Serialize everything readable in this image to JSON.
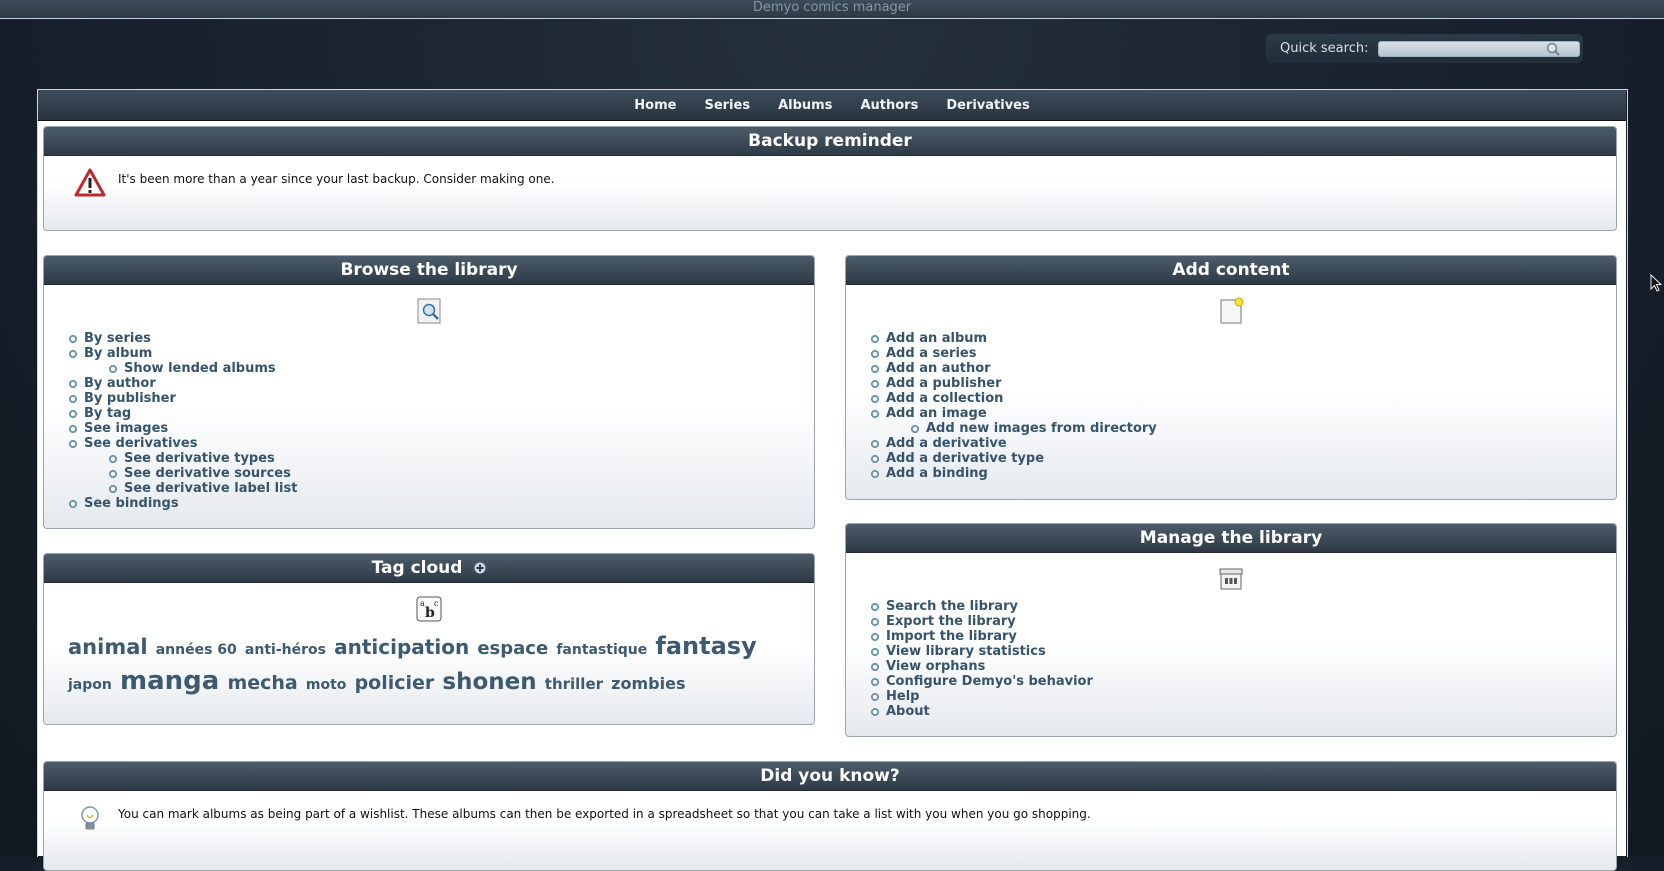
{
  "window": {
    "title": "Demyo comics manager"
  },
  "quick_search": {
    "label": "Quick search:",
    "value": "",
    "placeholder": ""
  },
  "nav": [
    {
      "label": "Home"
    },
    {
      "label": "Series"
    },
    {
      "label": "Albums"
    },
    {
      "label": "Authors"
    },
    {
      "label": "Derivatives"
    }
  ],
  "backup": {
    "title": "Backup reminder",
    "message": "It's been more than a year since your last backup. Consider making one."
  },
  "browse": {
    "title": "Browse the library",
    "items": [
      {
        "label": "By series"
      },
      {
        "label": "By album",
        "children": [
          {
            "label": "Show lended albums"
          }
        ]
      },
      {
        "label": "By author"
      },
      {
        "label": "By publisher"
      },
      {
        "label": "By tag"
      },
      {
        "label": "See images"
      },
      {
        "label": "See derivatives",
        "children": [
          {
            "label": "See derivative types"
          },
          {
            "label": "See derivative sources"
          },
          {
            "label": "See derivative label list"
          }
        ]
      },
      {
        "label": "See bindings"
      }
    ]
  },
  "add": {
    "title": "Add content",
    "items": [
      {
        "label": "Add an album"
      },
      {
        "label": "Add a series"
      },
      {
        "label": "Add an author"
      },
      {
        "label": "Add a publisher"
      },
      {
        "label": "Add a collection"
      },
      {
        "label": "Add an image",
        "children": [
          {
            "label": "Add new images from directory"
          }
        ]
      },
      {
        "label": "Add a derivative"
      },
      {
        "label": "Add a derivative type"
      },
      {
        "label": "Add a binding"
      }
    ]
  },
  "tagcloud": {
    "title": "Tag cloud",
    "tags": [
      {
        "label": "animal",
        "size": 21
      },
      {
        "label": "années 60",
        "size": 14
      },
      {
        "label": "anti-héros",
        "size": 14
      },
      {
        "label": "anticipation",
        "size": 20
      },
      {
        "label": "espace",
        "size": 18
      },
      {
        "label": "fantastique",
        "size": 14
      },
      {
        "label": "fantasy",
        "size": 24
      },
      {
        "label": "japon",
        "size": 14
      },
      {
        "label": "manga",
        "size": 26
      },
      {
        "label": "mecha",
        "size": 19
      },
      {
        "label": "moto",
        "size": 14
      },
      {
        "label": "policier",
        "size": 19
      },
      {
        "label": "shonen",
        "size": 23
      },
      {
        "label": "thriller",
        "size": 15
      },
      {
        "label": "zombies",
        "size": 16
      }
    ]
  },
  "manage": {
    "title": "Manage the library",
    "items": [
      {
        "label": "Search the library"
      },
      {
        "label": "Export the library"
      },
      {
        "label": "Import the library"
      },
      {
        "label": "View library statistics"
      },
      {
        "label": "View orphans"
      },
      {
        "label": "Configure Demyo's behavior"
      },
      {
        "label": "Help"
      },
      {
        "label": "About"
      }
    ]
  },
  "tip": {
    "title": "Did you know?",
    "message": "You can mark albums as being part of a wishlist. These albums can then be exported in a spreadsheet so that you can take a list with you when you go shopping."
  },
  "colors": {
    "header": "#2d3a46",
    "link": "#36546b",
    "tag": "#3d5a70"
  }
}
